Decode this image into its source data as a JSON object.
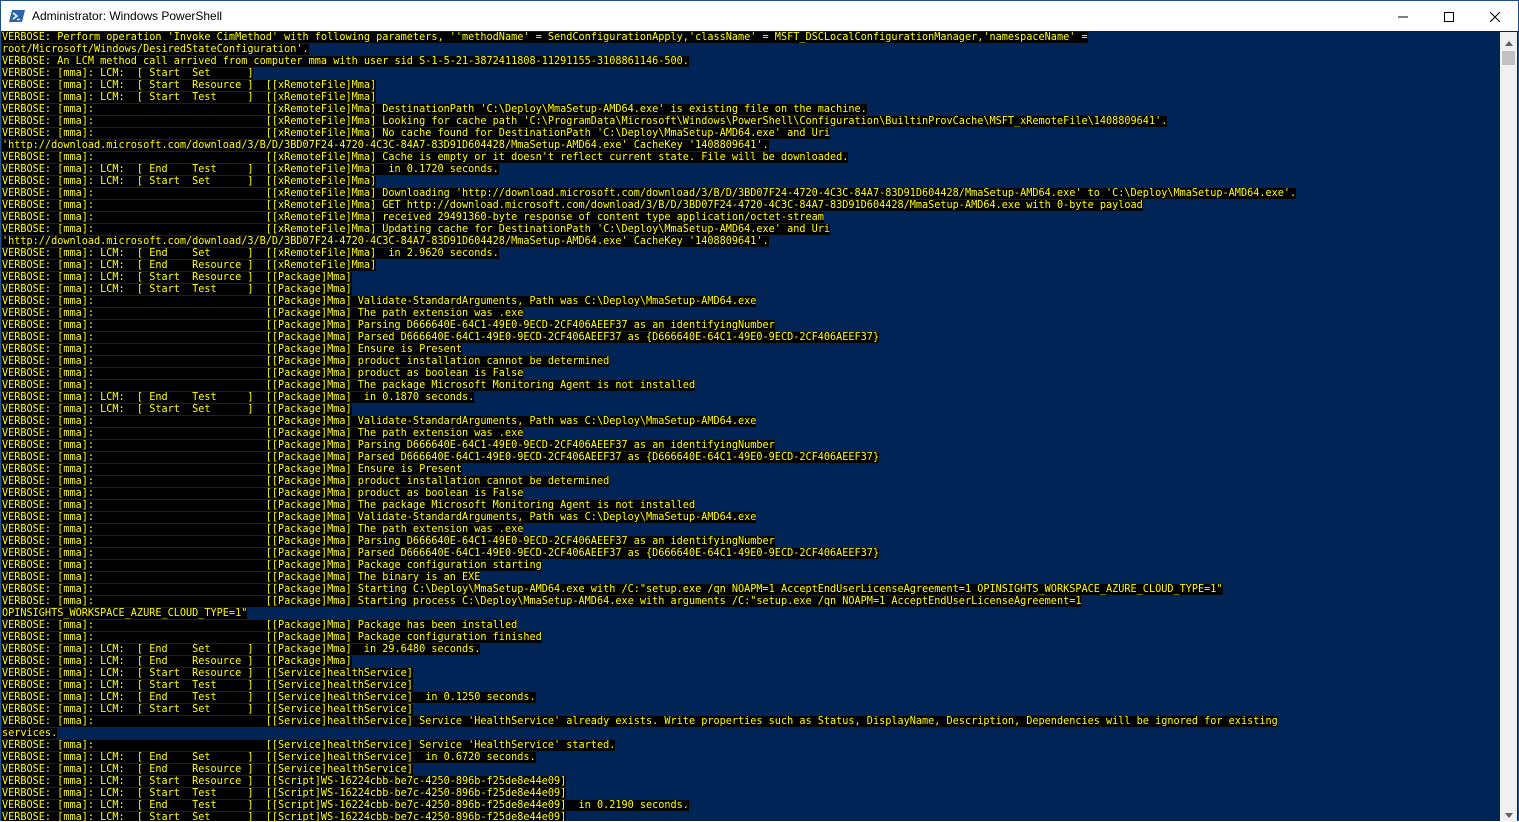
{
  "window": {
    "title": "Administrator: Windows PowerShell"
  },
  "icons": {
    "app": "powershell-icon",
    "minimize": "minimize-icon",
    "maximize": "maximize-icon",
    "close": "close-icon"
  },
  "colors": {
    "console_bg": "#012456",
    "text_fg": "#ffff00",
    "text_bg": "#000000"
  },
  "console": {
    "lines": [
      "VERBOSE: Perform operation 'Invoke CimMethod' with following parameters, ''methodName' = SendConfigurationApply,'className' = MSFT_DSCLocalConfigurationManager,'namespaceName' =",
      "root/Microsoft/Windows/DesiredStateConfiguration'.",
      "VERBOSE: An LCM method call arrived from computer mma with user sid S-1-5-21-3872411808-11291155-3108861146-500.",
      "VERBOSE: [mma]: LCM:  [ Start  Set      ]",
      "VERBOSE: [mma]: LCM:  [ Start  Resource ]  [[xRemoteFile]Mma]",
      "VERBOSE: [mma]: LCM:  [ Start  Test     ]  [[xRemoteFile]Mma]",
      "VERBOSE: [mma]:                            [[xRemoteFile]Mma] DestinationPath 'C:\\Deploy\\MmaSetup-AMD64.exe' is existing file on the machine.",
      "VERBOSE: [mma]:                            [[xRemoteFile]Mma] Looking for cache path 'C:\\ProgramData\\Microsoft\\Windows\\PowerShell\\Configuration\\BuiltinProvCache\\MSFT_xRemoteFile\\1408809641'.",
      "VERBOSE: [mma]:                            [[xRemoteFile]Mma] No cache found for DestinationPath 'C:\\Deploy\\MmaSetup-AMD64.exe' and Uri",
      "'http://download.microsoft.com/download/3/B/D/3BD07F24-4720-4C3C-84A7-83D91D604428/MmaSetup-AMD64.exe' CacheKey '1408809641'.",
      "VERBOSE: [mma]:                            [[xRemoteFile]Mma] Cache is empty or it doesn't reflect current state. File will be downloaded.",
      "VERBOSE: [mma]: LCM:  [ End    Test     ]  [[xRemoteFile]Mma]  in 0.1720 seconds.",
      "VERBOSE: [mma]: LCM:  [ Start  Set      ]  [[xRemoteFile]Mma]",
      "VERBOSE: [mma]:                            [[xRemoteFile]Mma] Downloading 'http://download.microsoft.com/download/3/B/D/3BD07F24-4720-4C3C-84A7-83D91D604428/MmaSetup-AMD64.exe' to 'C:\\Deploy\\MmaSetup-AMD64.exe'.",
      "VERBOSE: [mma]:                            [[xRemoteFile]Mma] GET http://download.microsoft.com/download/3/B/D/3BD07F24-4720-4C3C-84A7-83D91D604428/MmaSetup-AMD64.exe with 0-byte payload",
      "VERBOSE: [mma]:                            [[xRemoteFile]Mma] received 29491360-byte response of content type application/octet-stream",
      "VERBOSE: [mma]:                            [[xRemoteFile]Mma] Updating cache for DestinationPath 'C:\\Deploy\\MmaSetup-AMD64.exe' and Uri",
      "'http://download.microsoft.com/download/3/B/D/3BD07F24-4720-4C3C-84A7-83D91D604428/MmaSetup-AMD64.exe' CacheKey '1408809641'.",
      "VERBOSE: [mma]: LCM:  [ End    Set      ]  [[xRemoteFile]Mma]  in 2.9620 seconds.",
      "VERBOSE: [mma]: LCM:  [ End    Resource ]  [[xRemoteFile]Mma]",
      "VERBOSE: [mma]: LCM:  [ Start  Resource ]  [[Package]Mma]",
      "VERBOSE: [mma]: LCM:  [ Start  Test     ]  [[Package]Mma]",
      "VERBOSE: [mma]:                            [[Package]Mma] Validate-StandardArguments, Path was C:\\Deploy\\MmaSetup-AMD64.exe",
      "VERBOSE: [mma]:                            [[Package]Mma] The path extension was .exe",
      "VERBOSE: [mma]:                            [[Package]Mma] Parsing D666640E-64C1-49E0-9ECD-2CF406AEEF37 as an identifyingNumber",
      "VERBOSE: [mma]:                            [[Package]Mma] Parsed D666640E-64C1-49E0-9ECD-2CF406AEEF37 as {D666640E-64C1-49E0-9ECD-2CF406AEEF37}",
      "VERBOSE: [mma]:                            [[Package]Mma] Ensure is Present",
      "VERBOSE: [mma]:                            [[Package]Mma] product installation cannot be determined",
      "VERBOSE: [mma]:                            [[Package]Mma] product as boolean is False",
      "VERBOSE: [mma]:                            [[Package]Mma] The package Microsoft Monitoring Agent is not installed",
      "VERBOSE: [mma]: LCM:  [ End    Test     ]  [[Package]Mma]  in 0.1870 seconds.",
      "VERBOSE: [mma]: LCM:  [ Start  Set      ]  [[Package]Mma]",
      "VERBOSE: [mma]:                            [[Package]Mma] Validate-StandardArguments, Path was C:\\Deploy\\MmaSetup-AMD64.exe",
      "VERBOSE: [mma]:                            [[Package]Mma] The path extension was .exe",
      "VERBOSE: [mma]:                            [[Package]Mma] Parsing D666640E-64C1-49E0-9ECD-2CF406AEEF37 as an identifyingNumber",
      "VERBOSE: [mma]:                            [[Package]Mma] Parsed D666640E-64C1-49E0-9ECD-2CF406AEEF37 as {D666640E-64C1-49E0-9ECD-2CF406AEEF37}",
      "VERBOSE: [mma]:                            [[Package]Mma] Ensure is Present",
      "VERBOSE: [mma]:                            [[Package]Mma] product installation cannot be determined",
      "VERBOSE: [mma]:                            [[Package]Mma] product as boolean is False",
      "VERBOSE: [mma]:                            [[Package]Mma] The package Microsoft Monitoring Agent is not installed",
      "VERBOSE: [mma]:                            [[Package]Mma] Validate-StandardArguments, Path was C:\\Deploy\\MmaSetup-AMD64.exe",
      "VERBOSE: [mma]:                            [[Package]Mma] The path extension was .exe",
      "VERBOSE: [mma]:                            [[Package]Mma] Parsing D666640E-64C1-49E0-9ECD-2CF406AEEF37 as an identifyingNumber",
      "VERBOSE: [mma]:                            [[Package]Mma] Parsed D666640E-64C1-49E0-9ECD-2CF406AEEF37 as {D666640E-64C1-49E0-9ECD-2CF406AEEF37}",
      "VERBOSE: [mma]:                            [[Package]Mma] Package configuration starting",
      "VERBOSE: [mma]:                            [[Package]Mma] The binary is an EXE",
      "VERBOSE: [mma]:                            [[Package]Mma] Starting C:\\Deploy\\MmaSetup-AMD64.exe with /C:\"setup.exe /qn NOAPM=1 AcceptEndUserLicenseAgreement=1 OPINSIGHTS_WORKSPACE_AZURE_CLOUD_TYPE=1\"",
      "VERBOSE: [mma]:                            [[Package]Mma] Starting process C:\\Deploy\\MmaSetup-AMD64.exe with arguments /C:\"setup.exe /qn NOAPM=1 AcceptEndUserLicenseAgreement=1",
      "OPINSIGHTS_WORKSPACE_AZURE_CLOUD_TYPE=1\"",
      "VERBOSE: [mma]:                            [[Package]Mma] Package has been installed",
      "VERBOSE: [mma]:                            [[Package]Mma] Package configuration finished",
      "VERBOSE: [mma]: LCM:  [ End    Set      ]  [[Package]Mma]  in 29.6480 seconds.",
      "VERBOSE: [mma]: LCM:  [ End    Resource ]  [[Package]Mma]",
      "VERBOSE: [mma]: LCM:  [ Start  Resource ]  [[Service]healthService]",
      "VERBOSE: [mma]: LCM:  [ Start  Test     ]  [[Service]healthService]",
      "VERBOSE: [mma]: LCM:  [ End    Test     ]  [[Service]healthService]  in 0.1250 seconds.",
      "VERBOSE: [mma]: LCM:  [ Start  Set      ]  [[Service]healthService]",
      "VERBOSE: [mma]:                            [[Service]healthService] Service 'HealthService' already exists. Write properties such as Status, DisplayName, Description, Dependencies will be ignored for existing",
      "services.",
      "VERBOSE: [mma]:                            [[Service]healthService] Service 'HealthService' started.",
      "VERBOSE: [mma]: LCM:  [ End    Set      ]  [[Service]healthService]  in 0.6720 seconds.",
      "VERBOSE: [mma]: LCM:  [ End    Resource ]  [[Service]healthService]",
      "VERBOSE: [mma]: LCM:  [ Start  Resource ]  [[Script]WS-16224cbb-be7c-4250-896b-f25de8e44e09]",
      "VERBOSE: [mma]: LCM:  [ Start  Test     ]  [[Script]WS-16224cbb-be7c-4250-896b-f25de8e44e09]",
      "VERBOSE: [mma]: LCM:  [ End    Test     ]  [[Script]WS-16224cbb-be7c-4250-896b-f25de8e44e09]  in 0.2190 seconds.",
      "VERBOSE: [mma]: LCM:  [ Start  Set      ]  [[Script]WS-16224cbb-be7c-4250-896b-f25de8e44e09]"
    ]
  }
}
